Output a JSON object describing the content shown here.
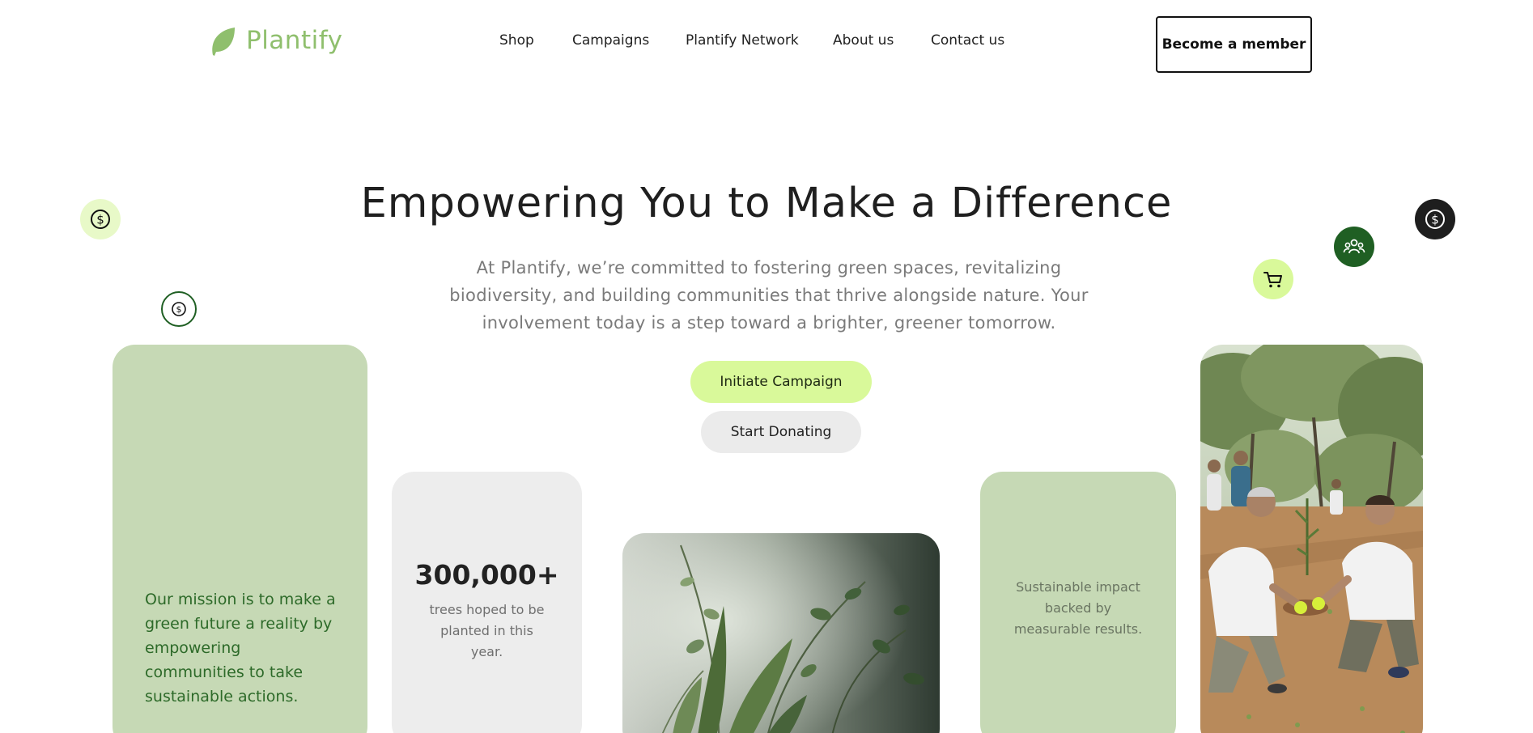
{
  "brand": {
    "name": "Plantify",
    "logo_icon": "leaf-icon",
    "color": "#8fbf6d"
  },
  "nav": {
    "items": [
      "Shop",
      "Campaigns",
      "Plantify Network",
      "About us",
      "Contact us"
    ],
    "cta_label": "Become a member"
  },
  "hero": {
    "title": "Empowering You to Make a Difference",
    "subtitle": "At Plantify, we’re committed to fostering green spaces, revitalizing biodiversity, and building communities that thrive alongside nature. Your involvement today is a step toward a brighter, greener tomorrow.",
    "primary_button": "Initiate Campaign",
    "secondary_button": "Start Donating"
  },
  "floating_icons": [
    "dollar-icon",
    "dollar-icon",
    "cart-icon",
    "community-icon",
    "dollar-icon"
  ],
  "cards": {
    "mission": "Our mission is to make a green future a reality by empowering communities to take sustainable actions.",
    "stat_value": "300,000+",
    "stat_label": "trees hoped to be planted in this year.",
    "impact": "Sustainable impact backed by measurable results."
  },
  "colors": {
    "accent_lime": "#d9f99a",
    "sage": "#c6d9b5",
    "dark_green": "#1f5f23",
    "mission_text": "#2d6a29",
    "light_gray": "#ededed",
    "black": "#1e1e1e"
  }
}
